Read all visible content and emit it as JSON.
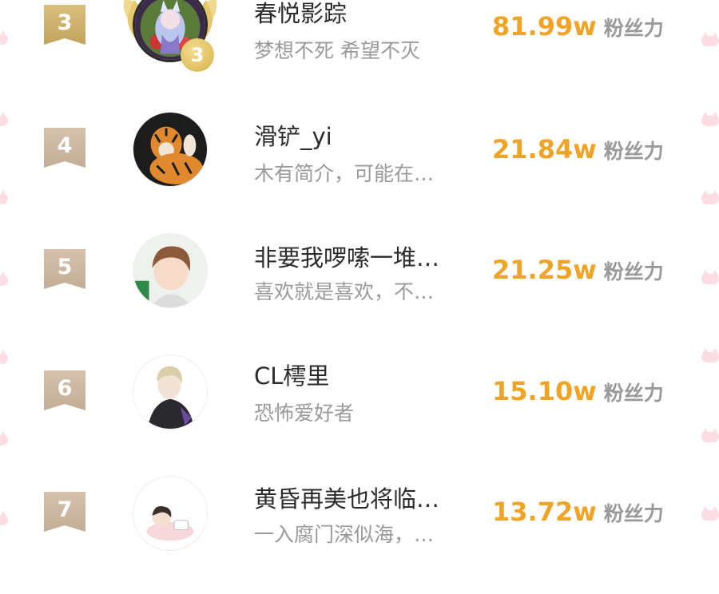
{
  "rows": [
    {
      "rank": "3",
      "name": "春悦影踪",
      "bio": "梦想不死  希望不灭",
      "fans_num": "81.99w",
      "fans_unit": "粉丝力",
      "avatar_icon": "anime-girl-avatar"
    },
    {
      "rank": "4",
      "name": "滑铲_yi",
      "bio": "木有简介，可能在…",
      "fans_num": "21.84w",
      "fans_unit": "粉丝力",
      "avatar_icon": "tiger-avatar"
    },
    {
      "rank": "5",
      "name": "非要我啰嗦一堆…",
      "bio": "喜欢就是喜欢，不…",
      "fans_num": "21.25w",
      "fans_unit": "粉丝力",
      "avatar_icon": "anime-boy-avatar"
    },
    {
      "rank": "6",
      "name": "CL樗里",
      "bio": "恐怖爱好者",
      "fans_num": "15.10w",
      "fans_unit": "粉丝力",
      "avatar_icon": "dark-coat-boy-avatar"
    },
    {
      "rank": "7",
      "name": "黄昏再美也将临…",
      "bio": "一入腐门深似海，…",
      "fans_num": "13.72w",
      "fans_unit": "粉丝力",
      "avatar_icon": "sleeping-boy-avatar"
    }
  ],
  "top3_badge_number": "3",
  "colors": {
    "fans": "#efa428",
    "gold_badge": "#c9aa66",
    "plain_badge": "#cbb59f",
    "decor": "#fbdde3"
  }
}
